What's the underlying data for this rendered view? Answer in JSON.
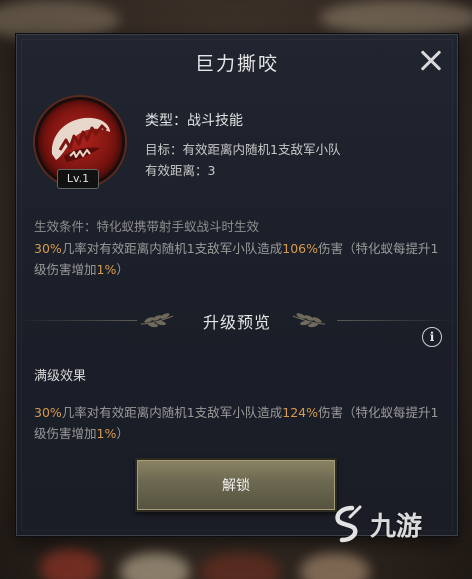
{
  "dialog": {
    "title": "巨力撕咬"
  },
  "skill": {
    "level": "Lv.1",
    "type": "类型：战斗技能",
    "target": "目标：有效距离内随机1支敌军小队",
    "range": "有效距离：3",
    "condition": "生效条件：特化蚁携带射手蚁战斗时生效",
    "current_effect": {
      "p1": "30%",
      "t1": "几率对有效距离内随机1支敌军小队造成",
      "p2": "106%",
      "t2": "伤害（特化蚁每提升1级伤害增加",
      "p3": "1%",
      "t3": "）"
    }
  },
  "upgrade": {
    "title": "升级预览",
    "info_symbol": "i",
    "max_label": "满级效果",
    "max_effect": {
      "p1": "30%",
      "t1": "几率对有效距离内随机1支敌军小队造成",
      "p2": "124%",
      "t2": "伤害（特化蚁每提升1级伤害增加",
      "p3": "1%",
      "t3": "）"
    }
  },
  "unlock_button": "解锁",
  "watermark": "九游",
  "icons": {
    "close": "close-icon",
    "skill": "fanged-maw-icon",
    "info": "info-icon",
    "leaf": "laurel-leaf-icon"
  },
  "colors": {
    "highlight": "#d79a4c",
    "dialog_bg": "#1d212b",
    "button": "#6e6a52"
  }
}
